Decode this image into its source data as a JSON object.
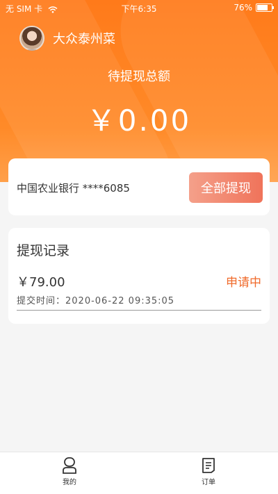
{
  "status_bar": {
    "carrier": "无 SIM 卡",
    "time": "下午6:35",
    "battery": "76%",
    "battery_level": 0.76
  },
  "header": {
    "shop_name": "大众泰州菜",
    "pending_label": "待提现总额",
    "pending_amount": "￥0.00"
  },
  "bank": {
    "name": "中国农业银行 ****6085",
    "withdraw_button": "全部提现"
  },
  "records": {
    "title": "提现记录",
    "items": [
      {
        "amount": "￥79.00",
        "status": "申请中",
        "time": "提交时间：2020-06-22 09:35:05"
      }
    ]
  },
  "tabbar": {
    "items": [
      {
        "label": "我的",
        "icon": "user-icon"
      },
      {
        "label": "订单",
        "icon": "order-icon"
      }
    ]
  },
  "colors": {
    "accent": "#ff7a1a",
    "status_pending": "#f06a2a",
    "button_gradient_start": "#f4a08a",
    "button_gradient_end": "#f0735a"
  }
}
